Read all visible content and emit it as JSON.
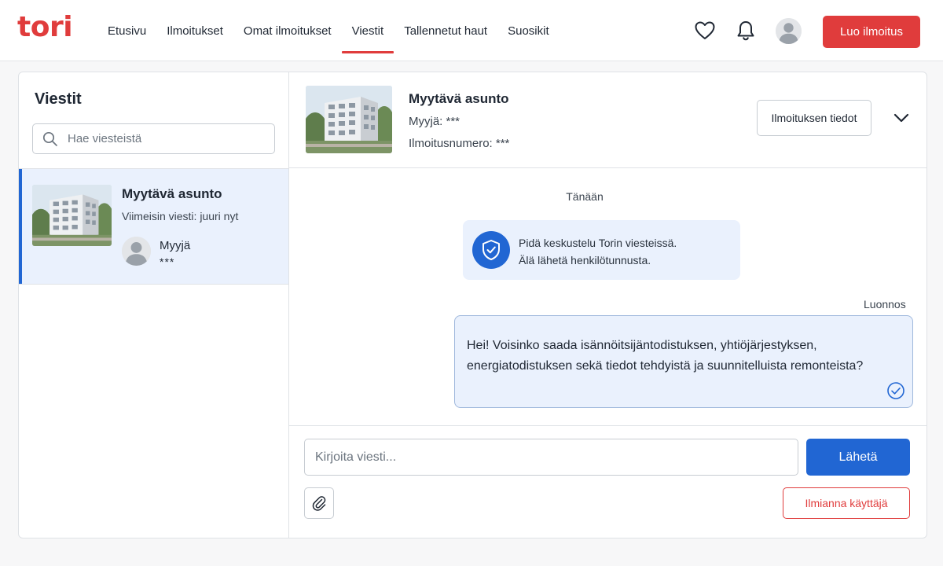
{
  "colors": {
    "brand_red": "#e03c3c",
    "accent_blue": "#2166d3",
    "selected_bg": "#eaf1fd"
  },
  "header": {
    "logo": "tori",
    "nav": [
      "Etusivu",
      "Ilmoitukset",
      "Omat ilmoitukset",
      "Viestit",
      "Tallennetut haut",
      "Suosikit"
    ],
    "active_nav": "Viestit",
    "icons": [
      "heart-icon",
      "bell-icon",
      "avatar"
    ],
    "create_label": "Luo ilmoitus"
  },
  "sidebar": {
    "title": "Viestit",
    "search_placeholder": "Hae viesteistä",
    "conversations": [
      {
        "title": "Myytävä asunto",
        "last_message": "Viimeisin viesti: juuri nyt",
        "seller_label": "Myyjä",
        "seller_name": "***",
        "selected": true
      }
    ]
  },
  "conversation": {
    "title": "Myytävä asunto",
    "seller": "Myyjä: ***",
    "listing_number": "Ilmoitusnumero: ***",
    "details_label": "Ilmoituksen tiedot",
    "date_label": "Tänään",
    "notice_line1": "Pidä keskustelu Torin viesteissä.",
    "notice_line2": "Älä lähetä henkilötunnusta.",
    "draft_label": "Luonnos",
    "draft_message": "Hei! Voisinko saada isännöitsijäntodistuksen, yhtiöjärjestyksen, energiatodistuksen sekä tiedot tehdyistä ja suunnitelluista remonteista?"
  },
  "composer": {
    "placeholder": "Kirjoita viesti...",
    "send_label": "Lähetä",
    "report_label": "Ilmianna käyttäjä"
  }
}
